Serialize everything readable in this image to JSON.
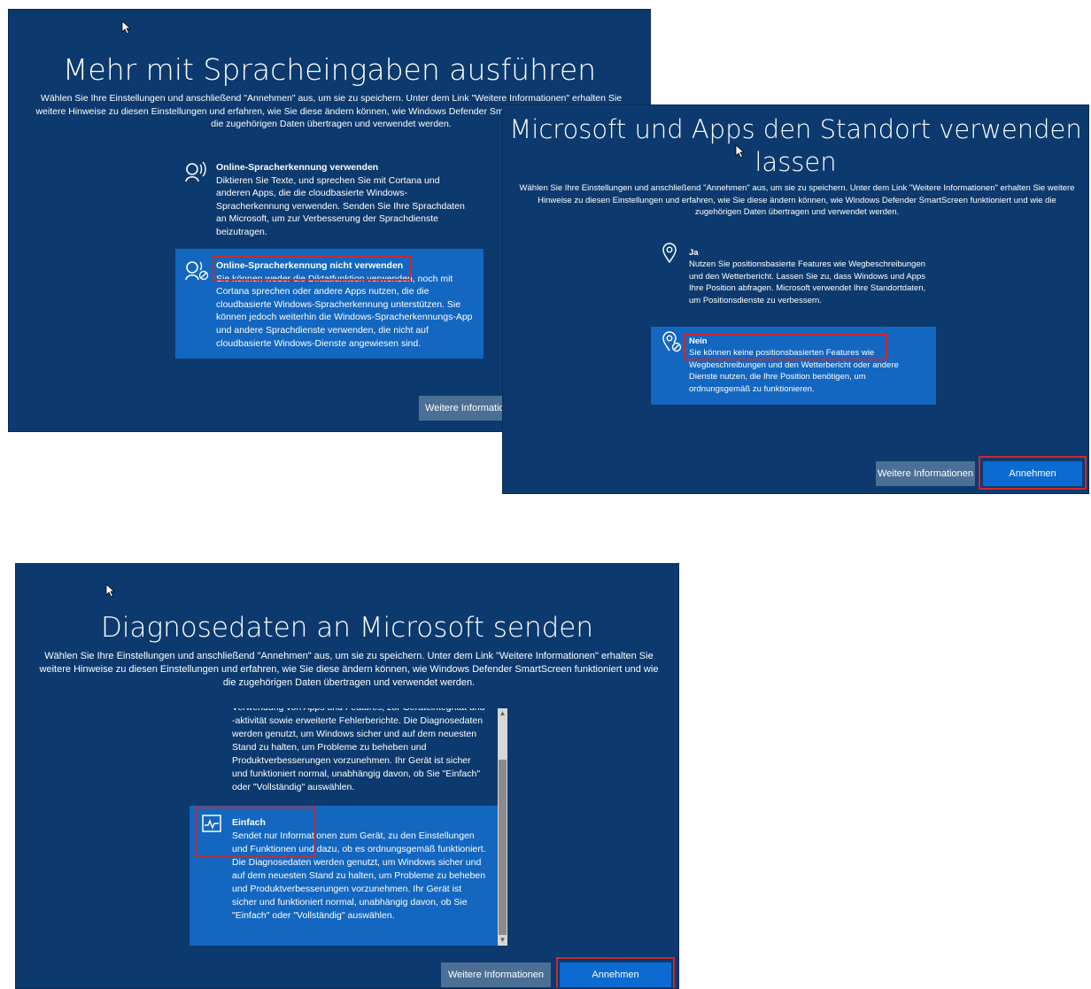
{
  "panel_speech": {
    "title": "Mehr mit Spracheingaben ausführen",
    "description": "Wählen Sie Ihre Einstellungen und anschließend \"Annehmen\" aus, um sie zu speichern. Unter dem Link \"Weitere Informationen\" erhalten Sie weitere Hinweise zu diesen Einstellungen und erfahren, wie Sie diese ändern können, wie Windows Defender SmartScreen funktioniert und wie die zugehörigen Daten übertragen und verwendet werden.",
    "options": [
      {
        "title": "Online-Spracherkennung verwenden",
        "body": "Diktieren Sie Texte, und sprechen Sie mit Cortana und anderen Apps, die die cloudbasierte Windows-Spracherkennung verwenden. Senden Sie Ihre Sprachdaten an Microsoft, um zur Verbesserung der Sprachdienste beizutragen.",
        "icon": "speech-icon"
      },
      {
        "title": "Online-Spracherkennung nicht verwenden",
        "body": "Sie können weder die Diktatfunktion verwenden, noch mit Cortana sprechen oder andere Apps nutzen, die die cloudbasierte Windows-Spracherkennung unterstützen. Sie können jedoch weiterhin die Windows-Spracherkennungs-App und andere Sprachdienste verwenden, die nicht auf cloudbasierte Windows-Dienste angewiesen sind.",
        "icon": "speech-off-icon"
      }
    ],
    "more_info": "Weitere Informationen"
  },
  "panel_location": {
    "title_line1": "Microsoft und Apps den Standort verwenden",
    "title_line2": "lassen",
    "description": "Wählen Sie Ihre Einstellungen und anschließend \"Annehmen\" aus, um sie zu speichern. Unter dem Link \"Weitere Informationen\" erhalten Sie weitere Hinweise zu diesen Einstellungen und erfahren, wie Sie diese ändern können, wie Windows Defender SmartScreen funktioniert und wie die zugehörigen Daten übertragen und verwendet werden.",
    "options": [
      {
        "title": "Ja",
        "body": "Nutzen Sie positionsbasierte Features wie Wegbeschreibungen und den Wetterbericht. Lassen Sie zu, dass Windows und Apps Ihre Position abfragen. Microsoft verwendet Ihre Standortdaten, um Positionsdienste zu verbessern.",
        "icon": "location-pin-icon"
      },
      {
        "title": "Nein",
        "body": "Sie können keine positionsbasierten Features wie Wegbeschreibungen und den Wetterbericht oder andere Dienste nutzen, die Ihre Position benötigen, um ordnungsgemäß zu funktionieren.",
        "icon": "location-off-icon"
      }
    ],
    "more_info": "Weitere Informationen",
    "accept": "Annehmen"
  },
  "panel_diagnostics": {
    "title": "Diagnosedaten an Microsoft senden",
    "description": "Wählen Sie Ihre Einstellungen und anschließend \"Annehmen\" aus, um sie zu speichern. Unter dem Link \"Weitere Informationen\" erhalten Sie weitere Hinweise zu diesen Einstellungen und erfahren, wie Sie diese ändern können, wie Windows Defender SmartScreen funktioniert und wie die zugehörigen Daten übertragen und verwendet werden.",
    "full_option_tail": "Verwendung von Apps und Features, zur Geräteintegrität und -aktivität sowie erweiterte Fehlerberichte. Die Diagnosedaten werden genutzt, um Windows sicher und auf dem neuesten Stand zu halten, um Probleme zu beheben und Produktverbesserungen vorzunehmen. Ihr Gerät ist sicher und funktioniert normal, unabhängig davon, ob Sie \"Einfach\" oder \"Vollständig\" auswählen.",
    "basic_option": {
      "title": "Einfach",
      "body": "Sendet nur Informationen zum Gerät, zu den Einstellungen und Funktionen und dazu, ob es ordnungsgemäß funktioniert. Die Diagnosedaten werden genutzt, um Windows sicher und auf dem neuesten Stand zu halten, um Probleme zu beheben und Produktverbesserungen vorzunehmen. Ihr Gerät ist sicher und funktioniert normal, unabhängig davon, ob Sie \"Einfach\" oder \"Vollständig\" auswählen.",
      "icon": "activity-chart-icon"
    },
    "more_info": "Weitere Informationen",
    "accept": "Annehmen"
  },
  "colors": {
    "panel_bg": "#0c3a6e",
    "selected_bg": "#1367c0",
    "accept_button": "#0b6bd1",
    "more_info_button": "#4c6f95",
    "highlight": "#c92a2a"
  }
}
